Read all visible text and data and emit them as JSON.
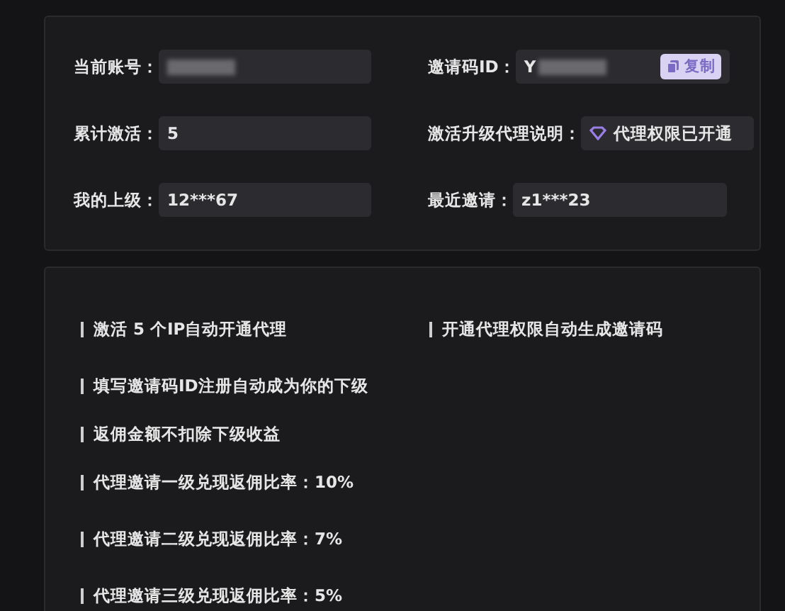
{
  "account": {
    "fields": [
      {
        "label": "当前账号：",
        "kind": "redacted"
      },
      {
        "label": "邀请码ID：",
        "kind": "redacted",
        "value": "Y",
        "button": "复制"
      },
      {
        "label": "累计激活：",
        "kind": "text",
        "value": "5"
      },
      {
        "label": "激活升级代理说明：",
        "kind": "badge",
        "value": "代理权限已开通"
      },
      {
        "label": "我的上级：",
        "kind": "text",
        "value": "12***67"
      },
      {
        "label": "最近邀请：",
        "kind": "text",
        "value": "z1***23"
      }
    ]
  },
  "notes": {
    "rows": [
      [
        "激活 5 个IP自动开通代理",
        "开通代理权限自动生成邀请码"
      ],
      [
        "填写邀请码ID注册自动成为你的下级"
      ],
      [
        "返佣金额不扣除下级收益"
      ],
      [
        "代理邀请一级兑现返佣比率：10%"
      ],
      [
        "代理邀请二级兑现返佣比率：7%"
      ],
      [
        "代理邀请三级兑现返佣比率：5%"
      ]
    ]
  }
}
